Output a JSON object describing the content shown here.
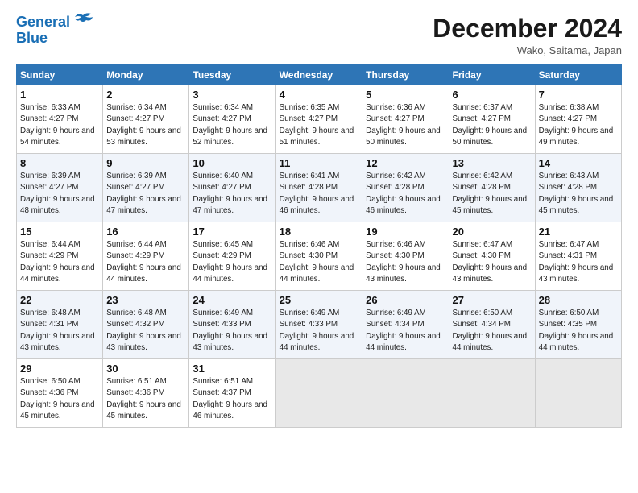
{
  "header": {
    "logo_line1": "General",
    "logo_line2": "Blue",
    "month": "December 2024",
    "location": "Wako, Saitama, Japan"
  },
  "weekdays": [
    "Sunday",
    "Monday",
    "Tuesday",
    "Wednesday",
    "Thursday",
    "Friday",
    "Saturday"
  ],
  "weeks": [
    [
      {
        "day": "1",
        "rise": "6:33 AM",
        "set": "4:27 PM",
        "daylight": "9 hours and 54 minutes."
      },
      {
        "day": "2",
        "rise": "6:34 AM",
        "set": "4:27 PM",
        "daylight": "9 hours and 53 minutes."
      },
      {
        "day": "3",
        "rise": "6:34 AM",
        "set": "4:27 PM",
        "daylight": "9 hours and 52 minutes."
      },
      {
        "day": "4",
        "rise": "6:35 AM",
        "set": "4:27 PM",
        "daylight": "9 hours and 51 minutes."
      },
      {
        "day": "5",
        "rise": "6:36 AM",
        "set": "4:27 PM",
        "daylight": "9 hours and 50 minutes."
      },
      {
        "day": "6",
        "rise": "6:37 AM",
        "set": "4:27 PM",
        "daylight": "9 hours and 50 minutes."
      },
      {
        "day": "7",
        "rise": "6:38 AM",
        "set": "4:27 PM",
        "daylight": "9 hours and 49 minutes."
      }
    ],
    [
      {
        "day": "8",
        "rise": "6:39 AM",
        "set": "4:27 PM",
        "daylight": "9 hours and 48 minutes."
      },
      {
        "day": "9",
        "rise": "6:39 AM",
        "set": "4:27 PM",
        "daylight": "9 hours and 47 minutes."
      },
      {
        "day": "10",
        "rise": "6:40 AM",
        "set": "4:27 PM",
        "daylight": "9 hours and 47 minutes."
      },
      {
        "day": "11",
        "rise": "6:41 AM",
        "set": "4:28 PM",
        "daylight": "9 hours and 46 minutes."
      },
      {
        "day": "12",
        "rise": "6:42 AM",
        "set": "4:28 PM",
        "daylight": "9 hours and 46 minutes."
      },
      {
        "day": "13",
        "rise": "6:42 AM",
        "set": "4:28 PM",
        "daylight": "9 hours and 45 minutes."
      },
      {
        "day": "14",
        "rise": "6:43 AM",
        "set": "4:28 PM",
        "daylight": "9 hours and 45 minutes."
      }
    ],
    [
      {
        "day": "15",
        "rise": "6:44 AM",
        "set": "4:29 PM",
        "daylight": "9 hours and 44 minutes."
      },
      {
        "day": "16",
        "rise": "6:44 AM",
        "set": "4:29 PM",
        "daylight": "9 hours and 44 minutes."
      },
      {
        "day": "17",
        "rise": "6:45 AM",
        "set": "4:29 PM",
        "daylight": "9 hours and 44 minutes."
      },
      {
        "day": "18",
        "rise": "6:46 AM",
        "set": "4:30 PM",
        "daylight": "9 hours and 44 minutes."
      },
      {
        "day": "19",
        "rise": "6:46 AM",
        "set": "4:30 PM",
        "daylight": "9 hours and 43 minutes."
      },
      {
        "day": "20",
        "rise": "6:47 AM",
        "set": "4:30 PM",
        "daylight": "9 hours and 43 minutes."
      },
      {
        "day": "21",
        "rise": "6:47 AM",
        "set": "4:31 PM",
        "daylight": "9 hours and 43 minutes."
      }
    ],
    [
      {
        "day": "22",
        "rise": "6:48 AM",
        "set": "4:31 PM",
        "daylight": "9 hours and 43 minutes."
      },
      {
        "day": "23",
        "rise": "6:48 AM",
        "set": "4:32 PM",
        "daylight": "9 hours and 43 minutes."
      },
      {
        "day": "24",
        "rise": "6:49 AM",
        "set": "4:33 PM",
        "daylight": "9 hours and 43 minutes."
      },
      {
        "day": "25",
        "rise": "6:49 AM",
        "set": "4:33 PM",
        "daylight": "9 hours and 44 minutes."
      },
      {
        "day": "26",
        "rise": "6:49 AM",
        "set": "4:34 PM",
        "daylight": "9 hours and 44 minutes."
      },
      {
        "day": "27",
        "rise": "6:50 AM",
        "set": "4:34 PM",
        "daylight": "9 hours and 44 minutes."
      },
      {
        "day": "28",
        "rise": "6:50 AM",
        "set": "4:35 PM",
        "daylight": "9 hours and 44 minutes."
      }
    ],
    [
      {
        "day": "29",
        "rise": "6:50 AM",
        "set": "4:36 PM",
        "daylight": "9 hours and 45 minutes."
      },
      {
        "day": "30",
        "rise": "6:51 AM",
        "set": "4:36 PM",
        "daylight": "9 hours and 45 minutes."
      },
      {
        "day": "31",
        "rise": "6:51 AM",
        "set": "4:37 PM",
        "daylight": "9 hours and 46 minutes."
      },
      null,
      null,
      null,
      null
    ]
  ]
}
